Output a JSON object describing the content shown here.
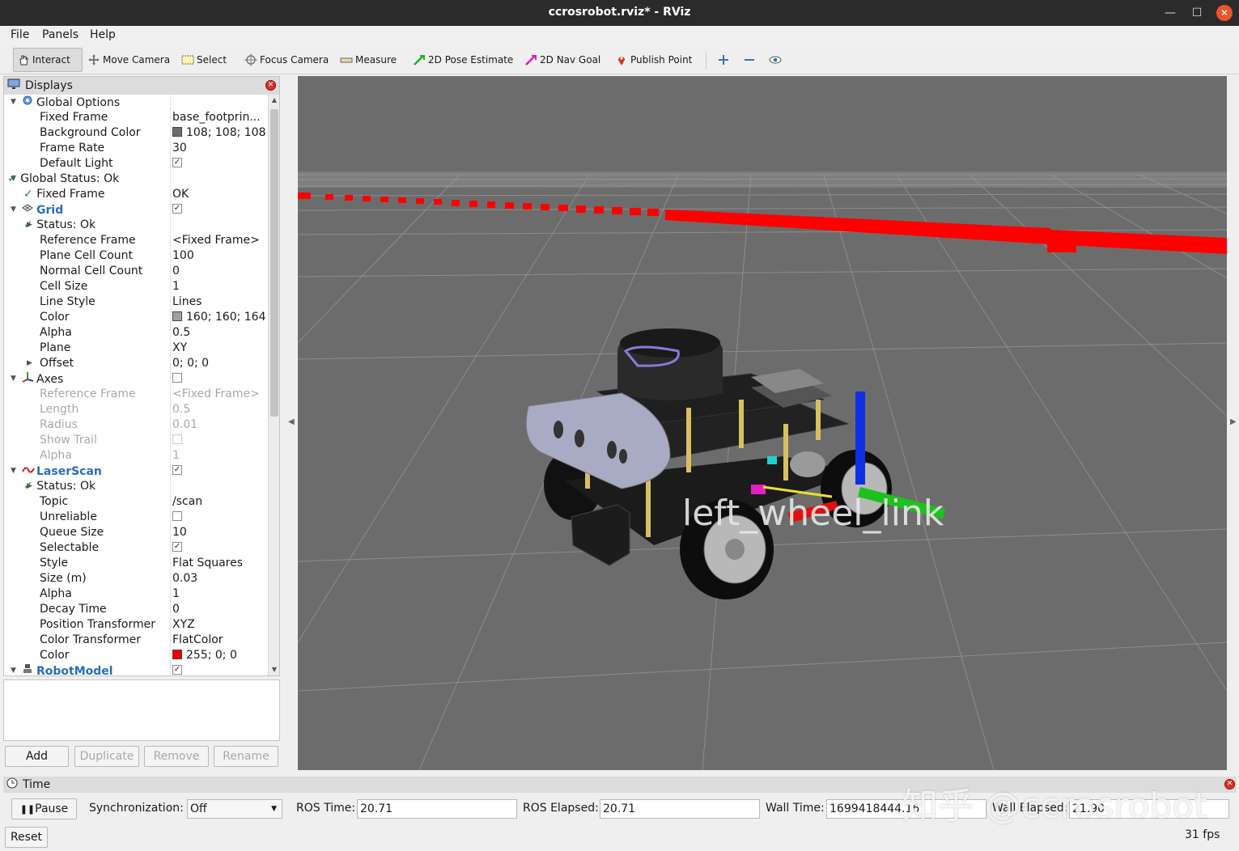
{
  "window": {
    "title": "ccrosrobot.rviz* - RViz"
  },
  "menu": [
    "File",
    "Panels",
    "Help"
  ],
  "toolbar": {
    "interact": "Interact",
    "move_camera": "Move Camera",
    "select": "Select",
    "focus_camera": "Focus Camera",
    "measure": "Measure",
    "pose_estimate": "2D Pose Estimate",
    "nav_goal": "2D Nav Goal",
    "publish_point": "Publish Point"
  },
  "displays": {
    "title": "Displays",
    "rows": [
      {
        "name": "Global Options",
        "value": "",
        "level": 0,
        "arrow": "down",
        "icon": "gear-icon"
      },
      {
        "name": "Fixed Frame",
        "value": "base_footprin...",
        "level": 1
      },
      {
        "name": "Background Color",
        "value": "108; 108; 108",
        "level": 1,
        "swatch": "#6c6c6c"
      },
      {
        "name": "Frame Rate",
        "value": "30",
        "level": 1
      },
      {
        "name": "Default Light",
        "value": "",
        "level": 1,
        "checkbox": true
      },
      {
        "name": "Global Status: Ok",
        "value": "",
        "level": 0,
        "arrow": "down",
        "status": true
      },
      {
        "name": "Fixed Frame",
        "value": "OK",
        "level": 1,
        "status": true
      },
      {
        "name": "Grid",
        "value": "",
        "level": 0,
        "arrow": "down",
        "icon": "grid-icon",
        "group": true,
        "checkbox": true
      },
      {
        "name": "Status: Ok",
        "value": "",
        "level": 1,
        "arrow": "right",
        "status": true
      },
      {
        "name": "Reference Frame",
        "value": "<Fixed Frame>",
        "level": 1
      },
      {
        "name": "Plane Cell Count",
        "value": "100",
        "level": 1
      },
      {
        "name": "Normal Cell Count",
        "value": "0",
        "level": 1
      },
      {
        "name": "Cell Size",
        "value": "1",
        "level": 1
      },
      {
        "name": "Line Style",
        "value": "Lines",
        "level": 1
      },
      {
        "name": "Color",
        "value": "160; 160; 164",
        "level": 1,
        "swatch": "#a0a0a4"
      },
      {
        "name": "Alpha",
        "value": "0.5",
        "level": 1
      },
      {
        "name": "Plane",
        "value": "XY",
        "level": 1
      },
      {
        "name": "Offset",
        "value": "0; 0; 0",
        "level": 1,
        "arrow": "right"
      },
      {
        "name": "Axes",
        "value": "",
        "level": 0,
        "arrow": "down",
        "icon": "axes-icon",
        "checkbox": false
      },
      {
        "name": "Reference Frame",
        "value": "<Fixed Frame>",
        "level": 1,
        "disabled": true
      },
      {
        "name": "Length",
        "value": "0.5",
        "level": 1,
        "disabled": true
      },
      {
        "name": "Radius",
        "value": "0.01",
        "level": 1,
        "disabled": true
      },
      {
        "name": "Show Trail",
        "value": "",
        "level": 1,
        "disabled": true,
        "checkbox": false
      },
      {
        "name": "Alpha",
        "value": "1",
        "level": 1,
        "disabled": true
      },
      {
        "name": "LaserScan",
        "value": "",
        "level": 0,
        "arrow": "down",
        "icon": "laserscan-icon",
        "group": true,
        "checkbox": true
      },
      {
        "name": "Status: Ok",
        "value": "",
        "level": 1,
        "arrow": "right",
        "status": true
      },
      {
        "name": "Topic",
        "value": "/scan",
        "level": 1
      },
      {
        "name": "Unreliable",
        "value": "",
        "level": 1,
        "checkbox": false
      },
      {
        "name": "Queue Size",
        "value": "10",
        "level": 1
      },
      {
        "name": "Selectable",
        "value": "",
        "level": 1,
        "checkbox": true
      },
      {
        "name": "Style",
        "value": "Flat Squares",
        "level": 1
      },
      {
        "name": "Size (m)",
        "value": "0.03",
        "level": 1
      },
      {
        "name": "Alpha",
        "value": "1",
        "level": 1
      },
      {
        "name": "Decay Time",
        "value": "0",
        "level": 1
      },
      {
        "name": "Position Transformer",
        "value": "XYZ",
        "level": 1
      },
      {
        "name": "Color Transformer",
        "value": "FlatColor",
        "level": 1
      },
      {
        "name": "Color",
        "value": "255; 0; 0",
        "level": 1,
        "swatch": "#ff0000"
      },
      {
        "name": "RobotModel",
        "value": "",
        "level": 0,
        "arrow": "down",
        "icon": "robot-icon",
        "group": true,
        "checkbox": true
      }
    ],
    "buttons": {
      "add": "Add",
      "duplicate": "Duplicate",
      "remove": "Remove",
      "rename": "Rename"
    }
  },
  "viewport": {
    "frame_label": "left_wheel_link"
  },
  "time": {
    "title": "Time",
    "pause": "Pause",
    "sync_label": "Synchronization:",
    "sync_value": "Off",
    "ros_time_label": "ROS Time:",
    "ros_time": "20.71",
    "ros_elapsed_label": "ROS Elapsed:",
    "ros_elapsed": "20.71",
    "wall_time_label": "Wall Time:",
    "wall_time": "1699418444.16",
    "wall_elapsed_label": "Wall Elapsed:",
    "wall_elapsed": "21.90",
    "reset": "Reset",
    "fps": "31 fps"
  },
  "watermark": "知乎 @ccrosrobot"
}
